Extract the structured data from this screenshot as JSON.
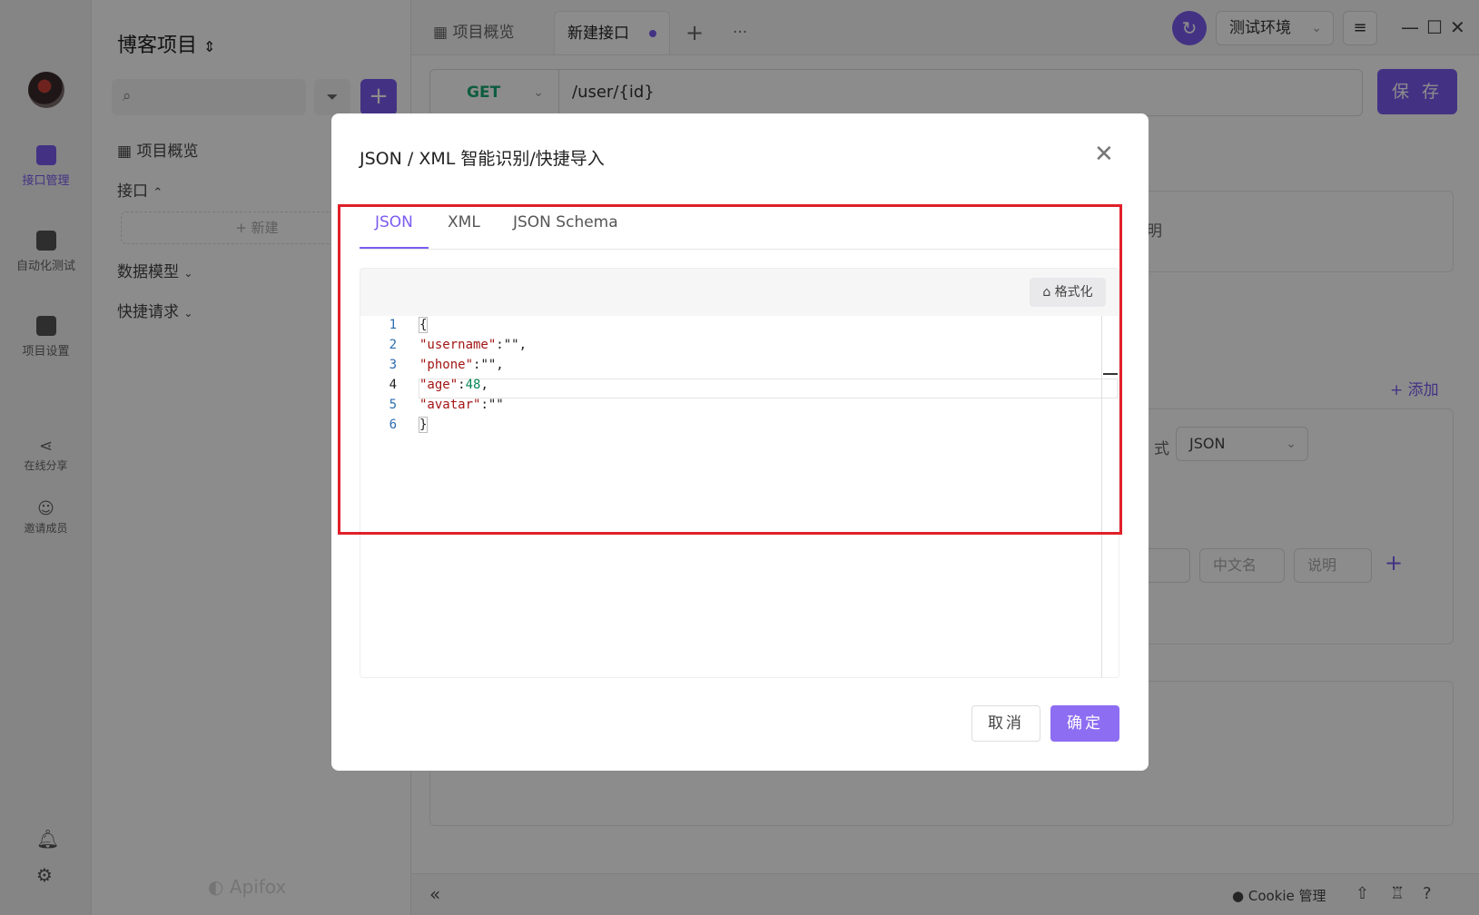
{
  "rail": {
    "items": [
      {
        "label": "接口管理"
      },
      {
        "label": "自动化测试"
      },
      {
        "label": "项目设置"
      },
      {
        "label": "在线分享"
      },
      {
        "label": "邀请成员"
      }
    ]
  },
  "sidebar": {
    "project_title": "博客项目",
    "overview": "项目概览",
    "interfaces": "接口",
    "new_label": "+ 新建",
    "data_models": "数据模型",
    "quick_requests": "快捷请求",
    "brand": "Apifox"
  },
  "tabs": {
    "overview": "项目概览",
    "new_interface": "新建接口",
    "add": "+",
    "more": "···"
  },
  "env": {
    "selected": "测试环境"
  },
  "request": {
    "method": "GET",
    "url": "/user/{id}",
    "save_label": "保 存"
  },
  "background": {
    "desc_fragment": "明",
    "add_label": "+ 添加",
    "format_fragment": "式",
    "format_value": "JSON",
    "field_cn_name": "中文名",
    "field_desc": "说明"
  },
  "bottombar": {
    "cookie_label": "Cookie 管理"
  },
  "modal": {
    "title": "JSON / XML 智能识别/快捷导入",
    "tabs": [
      {
        "label": "JSON"
      },
      {
        "label": "XML"
      },
      {
        "label": "JSON Schema"
      }
    ],
    "format_button": "格式化",
    "line_numbers": [
      "1",
      "2",
      "3",
      "4",
      "5",
      "6"
    ],
    "code": {
      "line1": "{",
      "line2_key": "\"username\"",
      "line2_rest": ":\"\",",
      "line3_key": "\"phone\"",
      "line3_rest": ":\"\",",
      "line4_key": "\"age\"",
      "line4_colon": ":",
      "line4_num": "48",
      "line4_comma": ",",
      "line5_key": "\"avatar\"",
      "line5_rest": ":\"\"",
      "line6": "}"
    },
    "cancel_label": "取消",
    "ok_label": "确定"
  },
  "colors": {
    "accent": "#7b5cf0",
    "method_get": "#19a974",
    "highlight": "#e0202a",
    "json_key": "#a31515",
    "json_number": "#098658"
  }
}
